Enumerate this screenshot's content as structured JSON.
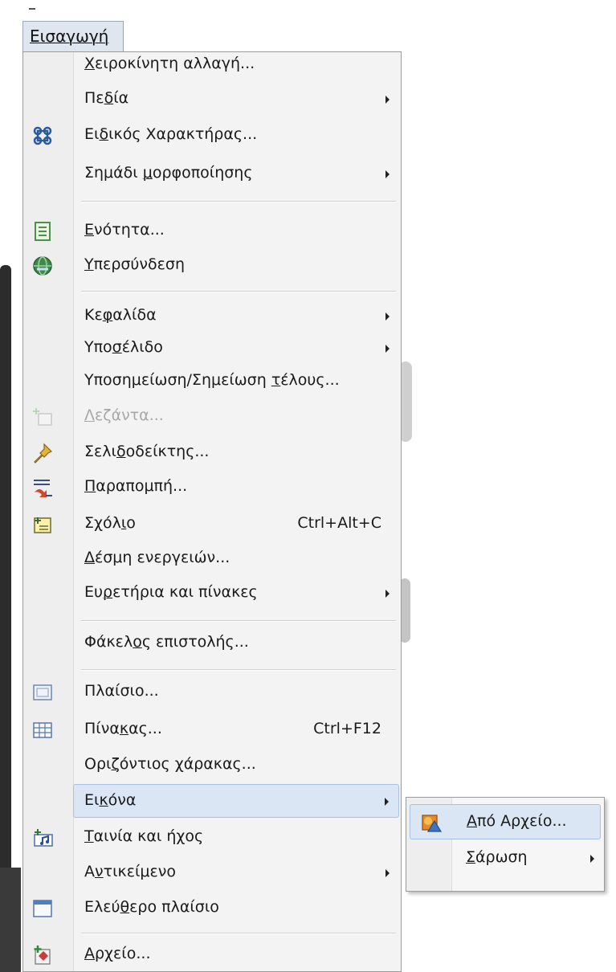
{
  "menubar": {
    "title": "Εισαγωγή"
  },
  "menu": {
    "items": [
      {
        "pre": "",
        "acc": "Χ",
        "post": "ειροκίνητη αλλαγή...",
        "icon": "",
        "shortcut": "",
        "submenu": false
      },
      {
        "pre": "Πε",
        "acc": "δ",
        "post": "ία",
        "icon": "",
        "shortcut": "",
        "submenu": true
      },
      {
        "pre": "Ει",
        "acc": "δ",
        "post": "ικός Χαρακτήρας...",
        "icon": "special-character-icon",
        "shortcut": "",
        "submenu": false
      },
      {
        "pre": "Σημάδι ",
        "acc": "μ",
        "post": "ορφοποίησης",
        "icon": "",
        "shortcut": "",
        "submenu": true
      },
      {
        "pre": "",
        "acc": "Ε",
        "post": "νότητα...",
        "icon": "section-icon",
        "shortcut": "",
        "submenu": false
      },
      {
        "pre": "",
        "acc": "Υ",
        "post": "περσύνδεση",
        "icon": "hyperlink-icon",
        "shortcut": "",
        "submenu": false
      },
      {
        "pre": "Κε",
        "acc": "φ",
        "post": "αλίδα",
        "icon": "",
        "shortcut": "",
        "submenu": true
      },
      {
        "pre": "Υπο",
        "acc": "σ",
        "post": "έλιδο",
        "icon": "",
        "shortcut": "",
        "submenu": true
      },
      {
        "pre": "Υποσημείωση/Σημείωση ",
        "acc": "τ",
        "post": "έλους...",
        "icon": "",
        "shortcut": "",
        "submenu": false
      },
      {
        "pre": "",
        "acc": "Λ",
        "post": "εζάντα...",
        "icon": "caption-icon",
        "shortcut": "",
        "submenu": false,
        "disabled": true
      },
      {
        "pre": "Σελι",
        "acc": "δ",
        "post": "οδείκτης...",
        "icon": "bookmark-pin-icon",
        "shortcut": "",
        "submenu": false
      },
      {
        "pre": "",
        "acc": "Π",
        "post": "αραπομπή...",
        "icon": "cross-reference-icon",
        "shortcut": "",
        "submenu": false
      },
      {
        "pre": "Σχόλ",
        "acc": "ι",
        "post": "ο",
        "icon": "comment-icon",
        "shortcut": "Ctrl+Alt+C",
        "submenu": false
      },
      {
        "pre": "",
        "acc": "Δ",
        "post": "έσμη ενεργειών...",
        "icon": "",
        "shortcut": "",
        "submenu": false
      },
      {
        "pre": "Ευ",
        "acc": "ρ",
        "post": "ετήρια και πίνακες",
        "icon": "",
        "shortcut": "",
        "submenu": true
      },
      {
        "pre": "Φάκελ",
        "acc": "ο",
        "post": "ς επιστολής...",
        "icon": "",
        "shortcut": "",
        "submenu": false
      },
      {
        "pre": "Πλαίσιο...",
        "acc": "",
        "post": "",
        "icon": "frame-icon",
        "shortcut": "",
        "submenu": false
      },
      {
        "pre": "Πίνα",
        "acc": "κ",
        "post": "ας...",
        "icon": "table-icon",
        "shortcut": "Ctrl+F12",
        "submenu": false
      },
      {
        "pre": "Ορι",
        "acc": "ζ",
        "post": "όντιος χάρακας...",
        "icon": "",
        "shortcut": "",
        "submenu": false
      },
      {
        "pre": "Ει",
        "acc": "κ",
        "post": "όνα",
        "icon": "",
        "shortcut": "",
        "submenu": true,
        "highlighted": true
      },
      {
        "pre": "",
        "acc": "Τ",
        "post": "αινία και ήχος",
        "icon": "movie-sound-icon",
        "shortcut": "",
        "submenu": false
      },
      {
        "pre": "Α",
        "acc": "ν",
        "post": "τικείμενο",
        "icon": "",
        "shortcut": "",
        "submenu": true
      },
      {
        "pre": "Ελεύ",
        "acc": "θ",
        "post": "ερο πλαίσιο",
        "icon": "floating-frame-icon",
        "shortcut": "",
        "submenu": false
      },
      {
        "pre": "",
        "acc": "Α",
        "post": "ρχείο...",
        "icon": "file-icon",
        "shortcut": "",
        "submenu": false
      }
    ]
  },
  "submenu": {
    "items": [
      {
        "pre": "",
        "acc": "Α",
        "post": "πό Αρχείο...",
        "icon": "image-from-file-icon",
        "submenu": false,
        "highlighted": true
      },
      {
        "pre": "",
        "acc": "Σ",
        "post": "άρωση",
        "icon": "",
        "submenu": true
      }
    ]
  }
}
